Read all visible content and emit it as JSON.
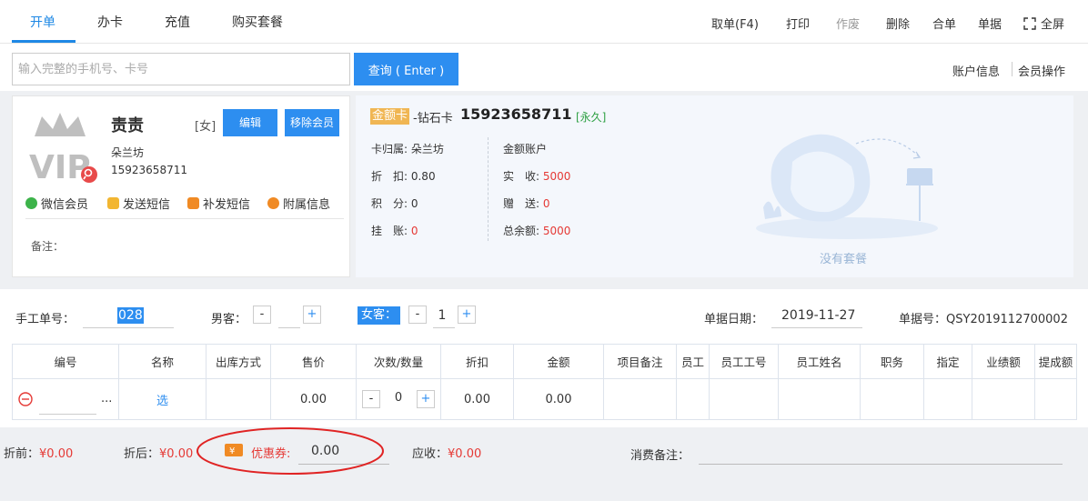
{
  "tabs": [
    {
      "label": "开单"
    },
    {
      "label": "办卡"
    },
    {
      "label": "充值"
    },
    {
      "label": "购买套餐"
    }
  ],
  "toolbar": {
    "take_order": "取单(F4)",
    "print": "打印",
    "void": "作废",
    "delete": "删除",
    "merge": "合单",
    "receipts": "单据",
    "fullscreen": "全屏"
  },
  "search": {
    "placeholder": "输入完整的手机号、卡号",
    "query_label": "查询 ( Enter )",
    "account_info": "账户信息",
    "member_ops": "会员操作"
  },
  "member": {
    "name": "责责",
    "gender": "[女]",
    "edit_label": "编辑",
    "remove_label": "移除会员",
    "store": "朵兰坊",
    "phone": "15923658711",
    "actions": [
      "微信会员",
      "发送短信",
      "补发短信",
      "附属信息"
    ],
    "remark_label": "备注："
  },
  "card": {
    "badge": "金额卡",
    "type": "-钻石卡",
    "number": "15923658711",
    "validity": "[永久]",
    "owner_label": "卡归属: ",
    "owner_value": "朵兰坊",
    "discount_label": "折　扣: ",
    "discount_value": "0.80",
    "points_label": "积　分: ",
    "points_value": "0",
    "credit_label": "挂　账: ",
    "credit_value": "0",
    "account_label": "金额账户",
    "paid_label": "实　收: ",
    "paid_value": "5000",
    "gift_label": "赠　送: ",
    "gift_value": "0",
    "balance_label": "总余额: ",
    "balance_value": "5000",
    "empty_package": "没有套餐"
  },
  "order": {
    "manual_label": "手工单号：",
    "manual_value": "028",
    "male_label": "男客：",
    "male_value": "",
    "female_label": "女客：",
    "female_value": "1",
    "date_label": "单据日期：",
    "date_value": "2019-11-27",
    "receipt_label": "单据号：",
    "receipt_value": "QSY2019112700002"
  },
  "table": {
    "headers": [
      "编号",
      "名称",
      "出库方式",
      "售价",
      "次数/数量",
      "折扣",
      "金额",
      "项目备注",
      "员工",
      "员工工号",
      "员工姓名",
      "职务",
      "指定",
      "业绩额",
      "提成额"
    ],
    "row": {
      "more": "...",
      "select": "选",
      "price": "0.00",
      "qty": "0",
      "discount": "0.00",
      "amount": "0.00"
    }
  },
  "footer": {
    "before_label": "折前：",
    "before_value": "¥0.00",
    "after_label": "折后：",
    "after_value": "¥0.00",
    "coupon_label": "优惠券:",
    "coupon_value": "0.00",
    "receivable_label": "应收：",
    "receivable_value": "¥0.00",
    "note_label": "消费备注："
  },
  "colors": {
    "accent": "#2d8ef0",
    "price_red": "#e53935",
    "highlight_circle": "#e02424",
    "badge_gold": "#f0b653"
  }
}
